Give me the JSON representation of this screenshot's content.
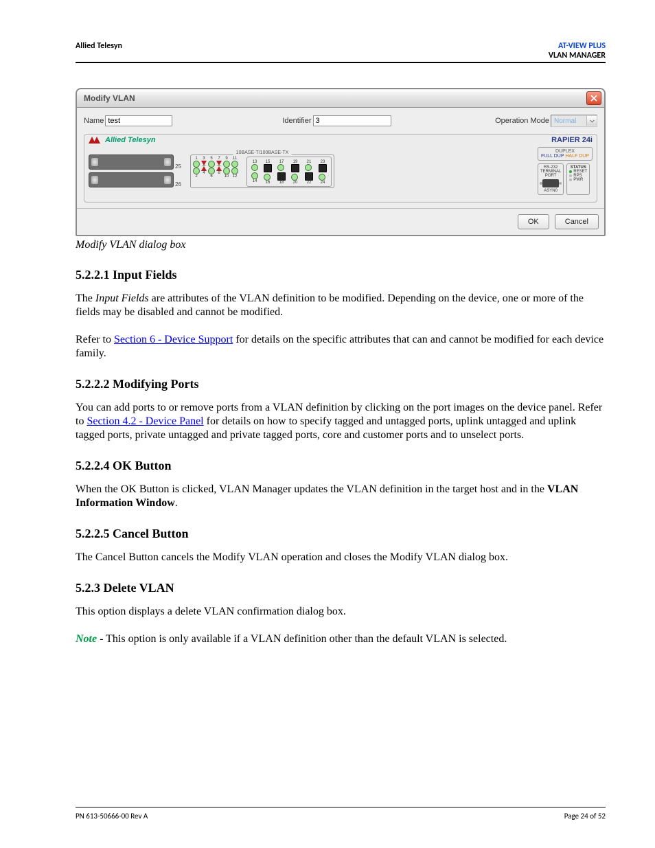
{
  "header": {
    "left": "Allied Telesyn",
    "right_top": "AT-VIEW PLUS",
    "right_bot": "VLAN MANAGER"
  },
  "dialog": {
    "title": "Modify VLAN",
    "fields": {
      "name_label": "Name",
      "name_value": "test",
      "identifier_label": "Identifier",
      "identifier_value": "3",
      "opmode_label": "Operation Mode",
      "opmode_value": "Normal"
    },
    "device": {
      "brand": "Allied Telesyn",
      "model": "RAPIER 24i",
      "slot_a_num": "25",
      "slot_b_num": "26",
      "cluster_label": "10BASE-T/100BASE-TX",
      "group1_ports": [
        "1",
        "2",
        "3",
        "4",
        "5",
        "6",
        "7",
        "8",
        "9",
        "10",
        "11",
        "12"
      ],
      "group2_ports": [
        "13",
        "14",
        "15",
        "16",
        "17",
        "18",
        "19",
        "20",
        "21",
        "22",
        "23",
        "24"
      ],
      "duplex": {
        "label": "DUPLEX",
        "full": "FULL DUP",
        "half": "HALF DUP"
      },
      "rs232": {
        "label1": "RS-232",
        "label2": "TERMINAL",
        "label3": "PORT",
        "sub": "ASYN0"
      },
      "status": {
        "label": "STATUS",
        "reset": "RESET",
        "rps": "RPS",
        "pwr": "PWR"
      }
    },
    "ok": "OK",
    "cancel": "Cancel"
  },
  "caption": "Modify VLAN dialog box",
  "sections": {
    "s1": {
      "heading": "5.2.2.1 Input Fields",
      "p1_a": "The ",
      "p1_b": "Input Fields",
      "p1_c": " are attributes of the VLAN definition to be modified. Depending on the device, one or more of the fields may be disabled and cannot be modified.",
      "p2_a": "Refer to ",
      "p2_link": "Section 6 - Device Support",
      "p2_b": " for details on the specific attributes that can and cannot be modified for each device family."
    },
    "s2": {
      "heading": "5.2.2.2 Modifying Ports",
      "p1_a": "You can add ports to or remove ports from a VLAN definition by clicking on the port images on the device panel. Refer to ",
      "p1_link": "Section 4.2 - Device Panel",
      "p1_b": " for details on how to specify tagged and untagged ports, uplink untagged and uplink tagged ports, private untagged and private tagged ports, core and customer ports and to unselect ports."
    },
    "s3": {
      "heading": "5.2.2.4 OK Button",
      "p1_a": "When the OK Button is clicked, VLAN Manager updates the VLAN definition in the target host and in the ",
      "p1_bold": "VLAN Information Window",
      "p1_b": "."
    },
    "s4": {
      "heading": "5.2.2.5 Cancel Button",
      "p1": "The Cancel Button cancels the Modify VLAN operation and closes the Modify VLAN dialog box."
    },
    "s5": {
      "heading": "5.2.3 Delete VLAN",
      "p1": "This option displays a delete VLAN confirmation dialog box.",
      "note_label": "Note",
      "note_body": " - This option is only available if a VLAN definition other than the default VLAN is selected."
    }
  },
  "footer": {
    "left": "PN 613-50666-00 Rev A",
    "right": "Page 24 of 52"
  }
}
